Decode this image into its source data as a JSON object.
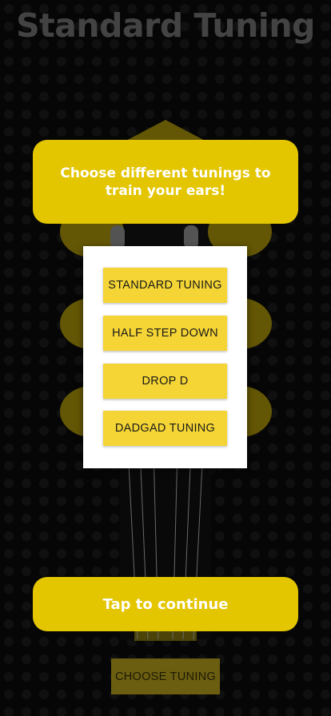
{
  "app": {
    "title": "Standard Tuning"
  },
  "intro": {
    "message": "Choose different tunings to train your ears!"
  },
  "tuning_menu": {
    "items": [
      {
        "label": "STANDARD TUNING"
      },
      {
        "label": "HALF STEP DOWN"
      },
      {
        "label": "DROP D"
      },
      {
        "label": "DADGAD TUNING"
      }
    ]
  },
  "continue": {
    "label": "Tap to continue"
  },
  "footer": {
    "choose_button": "CHOOSE TUNING"
  },
  "colors": {
    "accent": "#e3c500",
    "menu_button": "#f5d535",
    "background": "#0b0b0b"
  }
}
